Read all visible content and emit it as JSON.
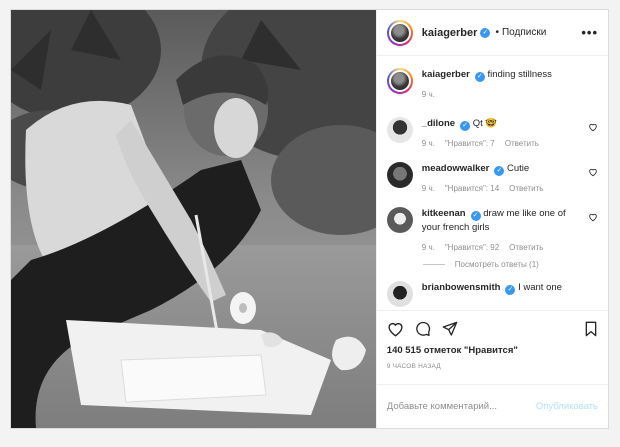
{
  "post": {
    "username": "kaiagerber",
    "follow_status": "Подписки",
    "separator": "•",
    "more": "•••"
  },
  "caption": {
    "username": "kaiagerber",
    "text": "finding stillness",
    "time": "9 ч."
  },
  "comments": [
    {
      "username": "_dilone",
      "text": "Qt",
      "emoji": "🤓",
      "time": "9 ч.",
      "likes": "\"Нравится\": 7",
      "reply": "Ответить"
    },
    {
      "username": "meadowwalker",
      "text": "Cutie",
      "time": "9 ч.",
      "likes": "\"Нравится\": 14",
      "reply": "Ответить"
    },
    {
      "username": "kitkeenan",
      "text": "draw me like one of your french girls",
      "time": "9 ч.",
      "likes": "\"Нравится\": 92",
      "reply": "Ответить",
      "view_replies": "Посмотреть ответы (1)"
    },
    {
      "username": "brianbowensmith",
      "text": "I want one"
    }
  ],
  "stats": {
    "likes": "140 515 отметок \"Нравится\"",
    "posted": "9 ЧАСОВ НАЗАД"
  },
  "composer": {
    "placeholder": "Добавьте комментарий...",
    "publish_label": "Опубликовать"
  },
  "colors": {
    "link_blue": "#3897f0",
    "publish_disabled": "#b2dffc",
    "muted_text": "#8e8e8e"
  }
}
